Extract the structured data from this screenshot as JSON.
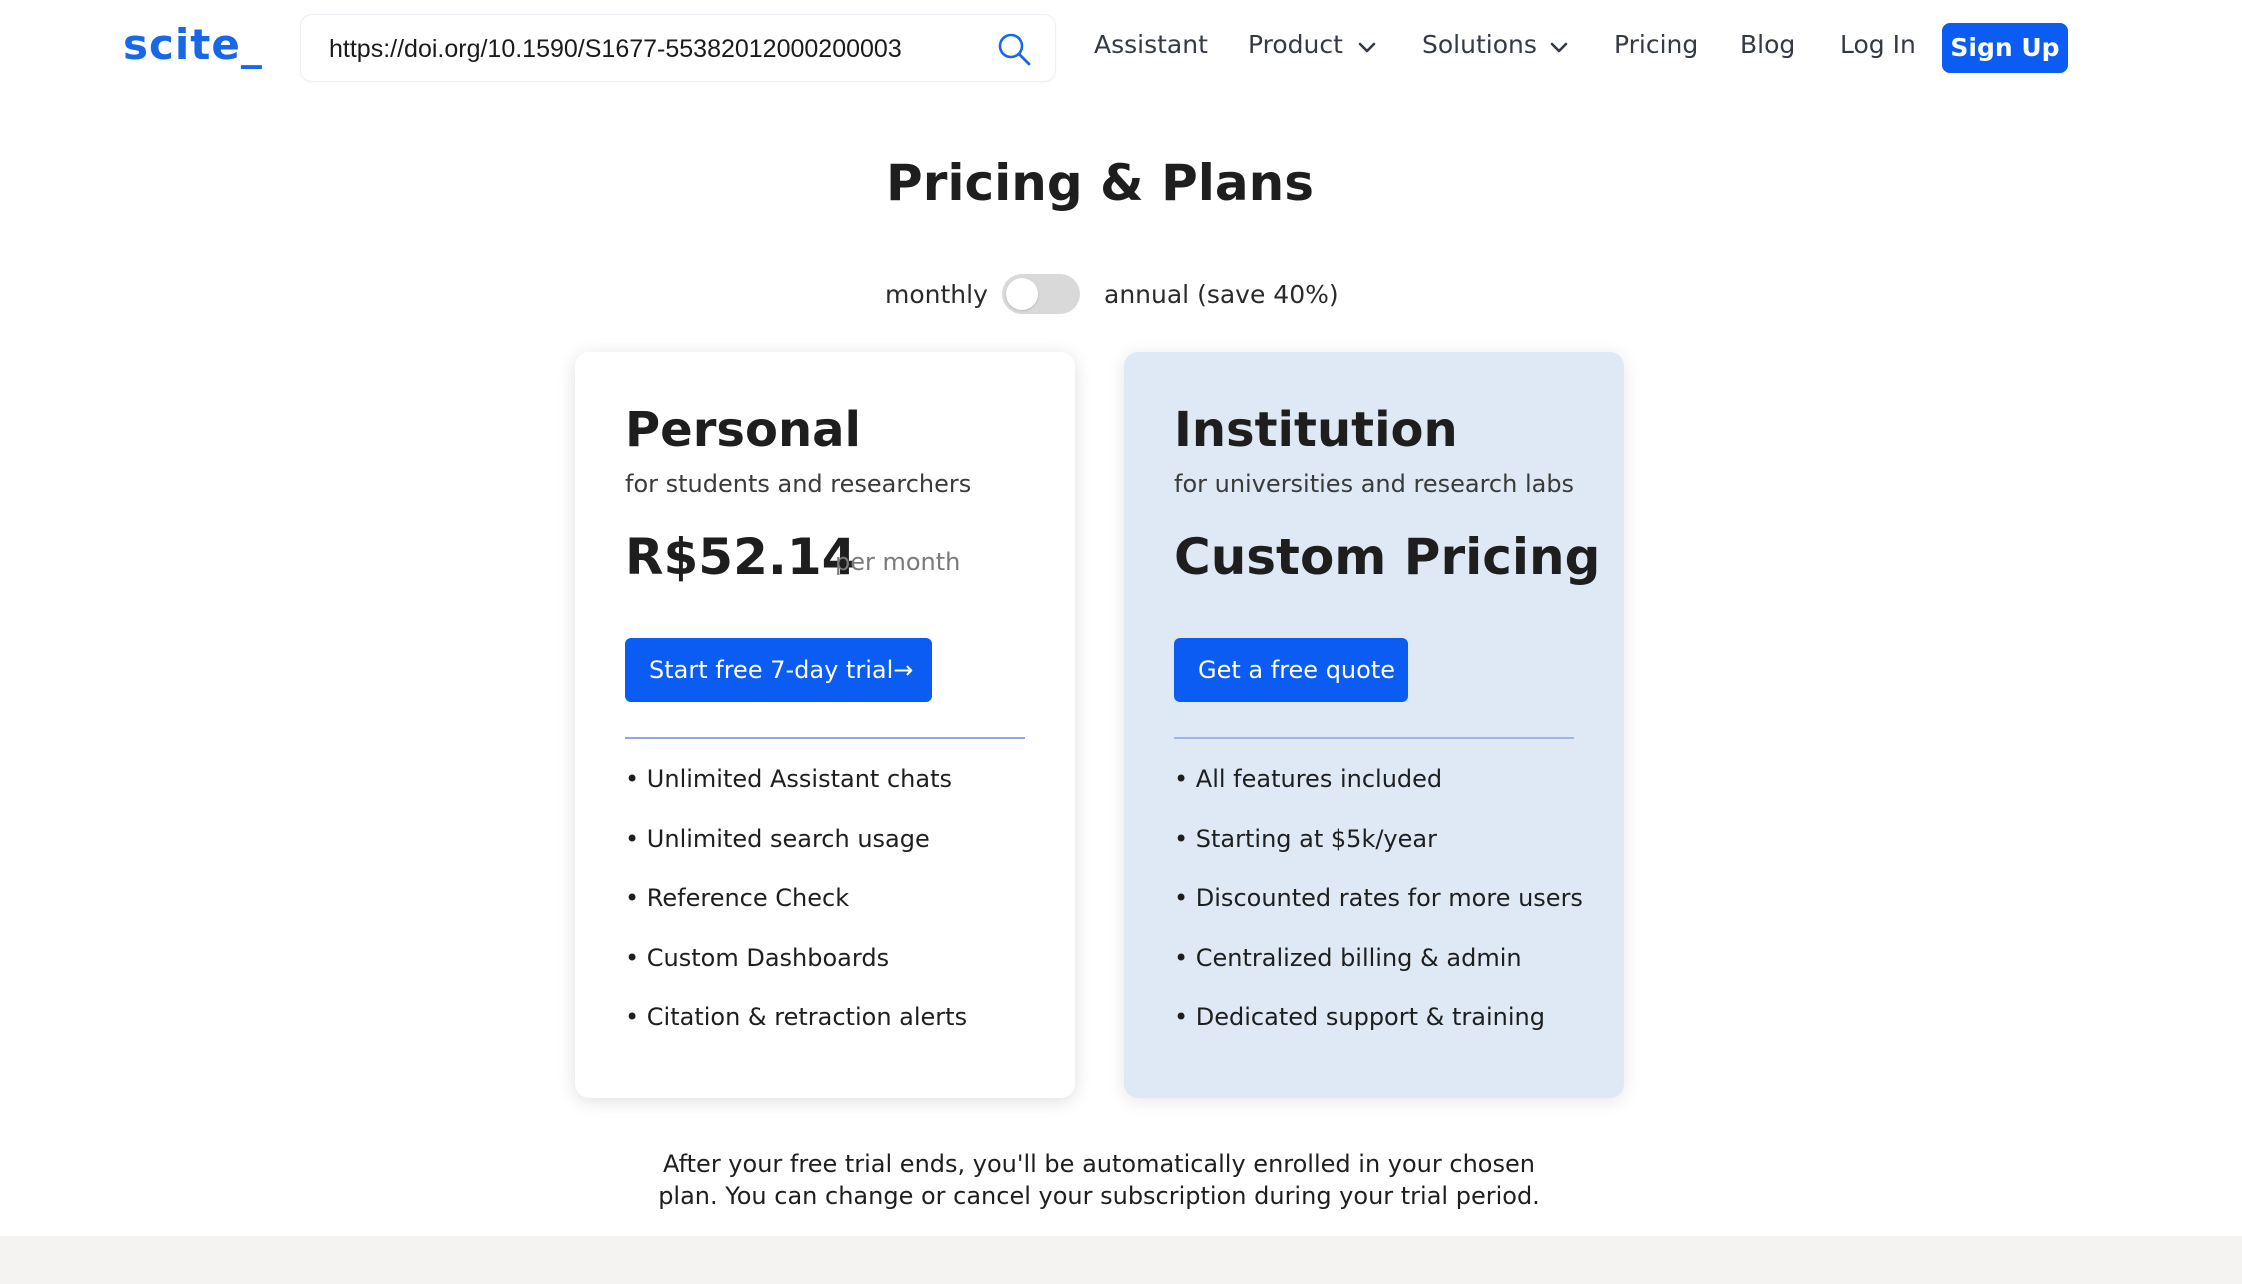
{
  "header": {
    "logo": "scite_",
    "search_value": "https://doi.org/10.1590/S1677-55382012000200003",
    "nav": {
      "assistant": "Assistant",
      "product": "Product",
      "solutions": "Solutions",
      "pricing": "Pricing",
      "blog": "Blog",
      "login": "Log In",
      "signup": "Sign Up"
    }
  },
  "main": {
    "title": "Pricing & Plans",
    "billing_toggle": {
      "left_label": "monthly",
      "right_label": "annual (save 40%)",
      "annual_selected": false
    },
    "plans": [
      {
        "name": "Personal",
        "subtitle": "for students and researchers",
        "price": "R$52.14",
        "price_period": "per month",
        "cta": "Start free 7-day trial→",
        "features": [
          "• Unlimited Assistant chats",
          "• Unlimited search usage",
          "• Reference Check",
          "• Custom Dashboards",
          "• Citation & retraction alerts"
        ]
      },
      {
        "name": "Institution",
        "subtitle": "for universities and research labs",
        "price": "Custom Pricing",
        "cta": "Get a free quote",
        "features": [
          "• All features included",
          "• Starting at $5k/year",
          "• Discounted rates for more users",
          "• Centralized billing & admin",
          "• Dedicated support & training"
        ]
      }
    ],
    "trial_note_line1": "After your free trial ends, you'll be automatically enrolled in your chosen",
    "trial_note_line2": "plan. You can change or cancel your subscription during your trial period."
  },
  "colors": {
    "brand": "#1668e8",
    "primary_button": "#0b5cf2",
    "institution_card": "#dfe9f5",
    "toggle_off": "#d9d9d9",
    "bottom_band": "#f4f3f1"
  },
  "icons": {
    "search": "search-icon",
    "dropdown": "chevron-down-icon"
  }
}
